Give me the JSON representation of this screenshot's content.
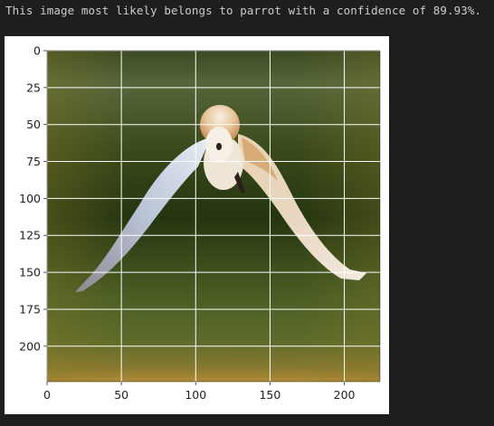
{
  "output": {
    "text": "This image most likely belongs to parrot with a confidence of 89.93%."
  },
  "chart_data": {
    "type": "image",
    "title": "",
    "xlabel": "",
    "ylabel": "",
    "xlim": [
      0,
      224
    ],
    "ylim": [
      224,
      0
    ],
    "grid": true,
    "x_ticks": [
      0,
      50,
      100,
      150,
      200
    ],
    "y_ticks": [
      0,
      25,
      50,
      75,
      100,
      125,
      150,
      175,
      200
    ],
    "image_subject": "barn owl in flight",
    "colors": {
      "background_top": "#3e4d22",
      "background_mid": "#2b3c14",
      "background_bottom": "#b08a36",
      "bird_white": "#f3ece0",
      "bird_buff": "#d4a36a",
      "bird_grey": "#9aa2b4",
      "grid": "#ffffff"
    }
  }
}
